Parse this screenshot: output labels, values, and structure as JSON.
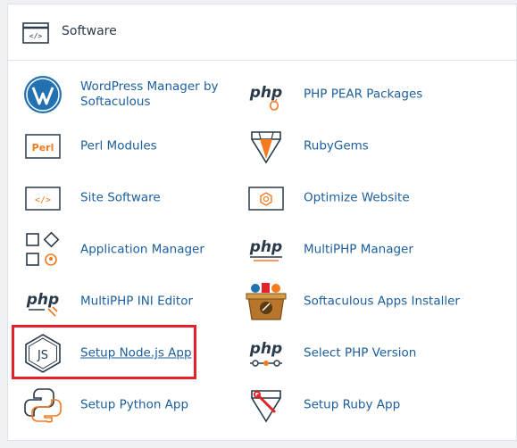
{
  "section": {
    "title": "Software",
    "icon": "code-window-icon"
  },
  "items": [
    {
      "label": "WordPress Manager by Softaculous",
      "icon": "wordpress-icon"
    },
    {
      "label": "PHP PEAR Packages",
      "icon": "php-pear-icon"
    },
    {
      "label": "Perl Modules",
      "icon": "perl-icon"
    },
    {
      "label": "RubyGems",
      "icon": "ruby-gem-icon"
    },
    {
      "label": "Site Software",
      "icon": "code-window-icon"
    },
    {
      "label": "Optimize Website",
      "icon": "optimize-icon"
    },
    {
      "label": "Application Manager",
      "icon": "app-grid-icon"
    },
    {
      "label": "MultiPHP Manager",
      "icon": "php-icon"
    },
    {
      "label": "MultiPHP INI Editor",
      "icon": "php-edit-icon"
    },
    {
      "label": "Softaculous Apps Installer",
      "icon": "softaculous-icon"
    },
    {
      "label": "Setup Node.js App",
      "icon": "nodejs-icon"
    },
    {
      "label": "Select PHP Version",
      "icon": "php-version-icon"
    },
    {
      "label": "Setup Python App",
      "icon": "python-icon"
    },
    {
      "label": "Setup Ruby App",
      "icon": "ruby-app-icon"
    }
  ],
  "colors": {
    "accent_link": "#1b5e9b",
    "highlight": "#e2232a",
    "icon_orange": "#f47a20",
    "icon_dark": "#293a4a"
  }
}
